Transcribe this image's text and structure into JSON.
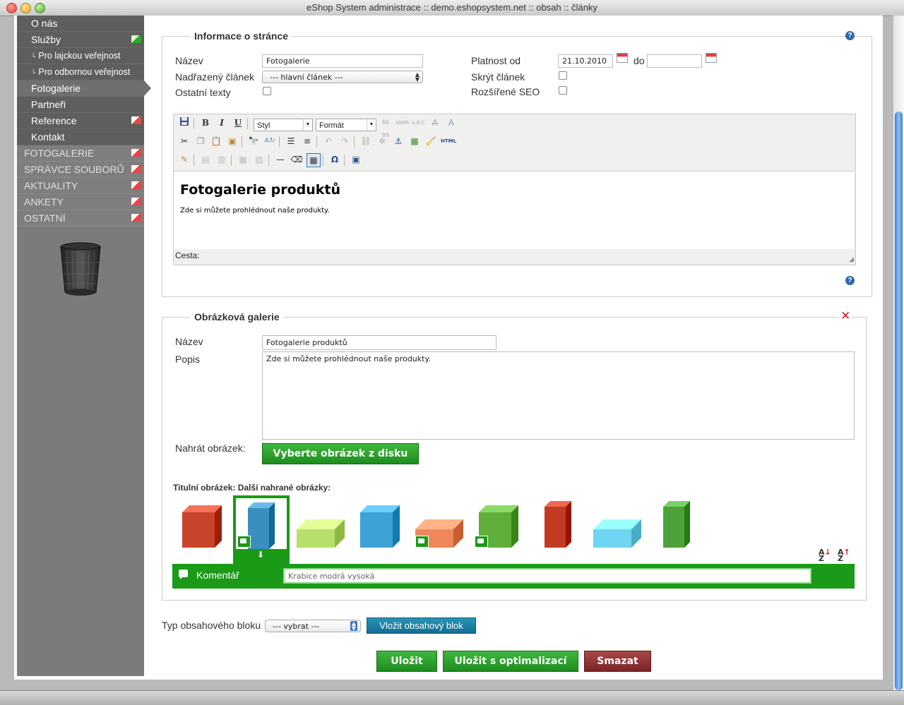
{
  "window": {
    "title": "eShop System administrace :: demo.eshopsystem.net :: obsah :: články"
  },
  "sidebar": {
    "items": [
      {
        "label": "O nás",
        "sub": false
      },
      {
        "label": "Služby",
        "sub": false,
        "folder": "green"
      },
      {
        "label": "Pro lajckou veřejnost",
        "sub": true
      },
      {
        "label": "Pro odbornou veřejnost",
        "sub": true
      },
      {
        "label": "Fotogalerie",
        "sub": false,
        "active": true
      },
      {
        "label": "Partneři",
        "sub": false
      },
      {
        "label": "Reference",
        "sub": false,
        "folder": "red"
      },
      {
        "label": "Kontakt",
        "sub": false
      }
    ],
    "sections": [
      "FOTOGALERIE",
      "SPRÁVCE SOUBORŮ",
      "AKTUALITY",
      "ANKETY",
      "OSTATNÍ"
    ],
    "trash_icon": "trash-bin-icon"
  },
  "page_info": {
    "legend": "Informace o stránce",
    "name_label": "Název",
    "name_value": "Fotogalerie",
    "parent_label": "Nadřazený článek",
    "parent_value": "--- hlavní článek ---",
    "other_texts_label": "Ostatní texty",
    "valid_from_label": "Platnost od",
    "valid_from_value": "21.10.2010",
    "to_label": "do",
    "to_value": "",
    "hide_label": "Skrýt článek",
    "seo_label": "Rozšířené SEO"
  },
  "editor": {
    "style_select": "Styl",
    "format_select": "Formát",
    "heading": "Fotogalerie produktů",
    "paragraph": "Zde si můžete prohlédnout naše produkty.",
    "path_label": "Cesta:"
  },
  "gallery": {
    "legend": "Obrázková galerie",
    "name_label": "Název",
    "name_value": "Fotogalerie produktů",
    "desc_label": "Popis",
    "desc_value": "Zde si můžete prohlédnout naše produkty.",
    "upload_label": "Nahrát obrázek:",
    "upload_button": "Vyberte obrázek z disku",
    "images_caption": "Titulní obrázek: Další nahrané obrázky:",
    "images": [
      {
        "color": "#c8452b",
        "shape": "cube"
      },
      {
        "color": "#3a8fbf",
        "shape": "tall",
        "selected": true,
        "comment": true
      },
      {
        "color": "#b7e06a",
        "shape": "flat"
      },
      {
        "color": "#3da2d6",
        "shape": "cube"
      },
      {
        "color": "#f0875a",
        "shape": "flat",
        "comment": true
      },
      {
        "color": "#5fae3c",
        "shape": "cube",
        "comment": true
      },
      {
        "color": "#c13b23",
        "shape": "tall"
      },
      {
        "color": "#6fd6f2",
        "shape": "flat"
      },
      {
        "color": "#4ea23a",
        "shape": "tall"
      }
    ],
    "comment_label": "Komentář",
    "comment_value": "Krabice modrá vysoká"
  },
  "content_block": {
    "type_label": "Typ obsahového bloku",
    "type_value": "--- vybrat ---",
    "insert_button": "Vložit obsahový blok"
  },
  "actions": {
    "save": "Uložit",
    "save_optimize": "Uložit s optimalizací",
    "delete": "Smazat"
  },
  "colors": {
    "accent_green": "#1a9a16",
    "delete_red": "#7a2525",
    "insert_blue": "#136e92"
  }
}
